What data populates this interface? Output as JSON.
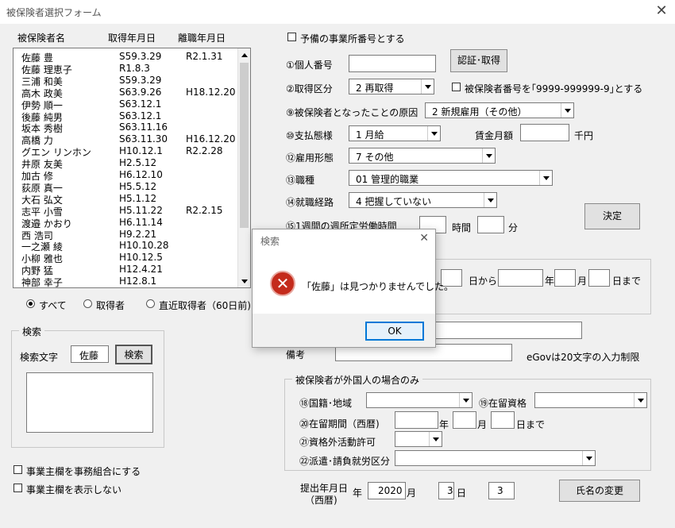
{
  "window": {
    "title": "被保険者選択フォーム"
  },
  "list": {
    "headers": [
      "被保険者名",
      "取得年月日",
      "離職年月日"
    ],
    "rows": [
      [
        "佐藤 豊",
        "S59.3.29",
        "R2.1.31"
      ],
      [
        "佐藤 理恵子",
        "R1.8.3",
        ""
      ],
      [
        "三浦 和美",
        "S59.3.29",
        ""
      ],
      [
        "高木 政美",
        "S63.9.26",
        "H18.12.20"
      ],
      [
        "伊勢 順一",
        "S63.12.1",
        ""
      ],
      [
        "後藤 純男",
        "S63.12.1",
        ""
      ],
      [
        "坂本 秀樹",
        "S63.11.16",
        ""
      ],
      [
        "高橋 力",
        "S63.11.30",
        "H16.12.20"
      ],
      [
        "グエン リンホン",
        "H10.12.1",
        "R2.2.28"
      ],
      [
        "井原 友美",
        "H2.5.12",
        ""
      ],
      [
        "加古 修",
        "H6.12.10",
        ""
      ],
      [
        "荻原 真一",
        "H5.5.12",
        ""
      ],
      [
        "大石 弘文",
        "H5.1.12",
        ""
      ],
      [
        "志平 小雪",
        "H5.11.22",
        "R2.2.15"
      ],
      [
        "渡邉 かおり",
        "H6.11.14",
        ""
      ],
      [
        "西 浩司",
        "H9.2.21",
        ""
      ],
      [
        "一之瀬 綾",
        "H10.10.28",
        ""
      ],
      [
        "小柳 雅也",
        "H10.12.5",
        ""
      ],
      [
        "内野 猛",
        "H12.4.21",
        ""
      ],
      [
        "神部 幸子",
        "H12.8.1",
        ""
      ]
    ]
  },
  "filter": {
    "all": "すべて",
    "acquired": "取得者",
    "recent": "直近取得者（60日前)"
  },
  "search": {
    "frame": "検索",
    "label": "検索文字",
    "value": "佐藤",
    "button": "検索"
  },
  "options": {
    "union": "事業主欄を事務組合にする",
    "hide_owner": "事業主欄を表示しない"
  },
  "form": {
    "spare_office": "予備の事業所番号とする",
    "personal_no": "①個人番号",
    "auth_button": "認証･取得",
    "acq_type": "②取得区分",
    "acq_type_value": "2 再取得",
    "insured_no_chk": "被保険者番号を｢9999-999999-9｣とする",
    "cause": "⑨被保険者となったことの原因",
    "cause_value": "2 新規雇用（その他）",
    "pay": "⑩支払態様",
    "pay_value": "1 月給",
    "wage": "賃金月額",
    "wage_unit": "千円",
    "emp_type": "⑫雇用形態",
    "emp_type_value": "7 その他",
    "job": "⑬職種",
    "job_value": "01 管理的職業",
    "route": "⑭就職経路",
    "route_value": "4 把握していない",
    "hours": "⑮1週間の週所定労働時間",
    "hours_unit": "時間",
    "min_unit": "分",
    "decide": "決定",
    "from": "日から",
    "year": "年",
    "month": "月",
    "until": "日まで",
    "note": "備考",
    "egov": "eGovは20文字の入力制限"
  },
  "foreign": {
    "frame": "被保険者が外国人の場合のみ",
    "nationality": "⑱国籍･地域",
    "status": "⑲在留資格",
    "period": "⑳在留期間（西暦)",
    "year": "年",
    "month": "月",
    "until": "日まで",
    "permit": "㉑資格外活動許可",
    "dispatch": "㉒派遣･請負就労区分"
  },
  "submit": {
    "label1": "提出年月日",
    "label2": "（西暦)",
    "nen": "年",
    "year": "2020",
    "tsuki": "月",
    "month": "3",
    "hi": "日",
    "day": "3",
    "rename": "氏名の変更"
  },
  "dialog": {
    "title": "検索",
    "message": "「佐藤」は見つかりませんでした。",
    "ok": "OK"
  },
  "colors": {
    "error_red": "#c42b1c"
  }
}
